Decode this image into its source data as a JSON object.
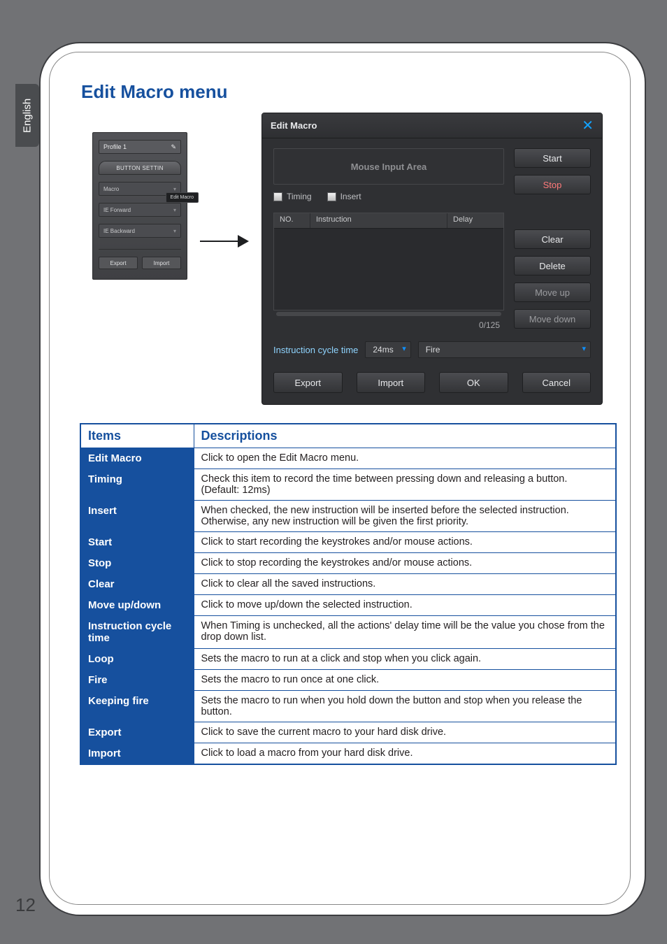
{
  "page_number": "12",
  "side_tab": "English",
  "section_title": "Edit Macro menu",
  "mini_panel": {
    "profile_label": "Profile 1",
    "tab_label": "BUTTON SETTIN",
    "rows": [
      {
        "label": "Macro",
        "submenu": "Edit Macro"
      },
      {
        "label": "IE Forward"
      },
      {
        "label": "IE Backward"
      }
    ],
    "export_label": "Export",
    "import_label": "Import"
  },
  "edit_macro_window": {
    "title": "Edit Macro",
    "mouse_input_area": "Mouse Input Area",
    "timing_label": "Timing",
    "insert_label": "Insert",
    "table_headers": {
      "no": "NO.",
      "instruction": "Instruction",
      "delay": "Delay"
    },
    "count": "0/125",
    "cycle_label": "Instruction cycle time",
    "cycle_value": "24ms",
    "mode_value": "Fire",
    "buttons": {
      "start": "Start",
      "stop": "Stop",
      "clear": "Clear",
      "delete": "Delete",
      "move_up": "Move up",
      "move_down": "Move down",
      "export": "Export",
      "import": "Import",
      "ok": "OK",
      "cancel": "Cancel"
    }
  },
  "desc_table": {
    "head_items": "Items",
    "head_desc": "Descriptions",
    "rows": [
      {
        "item": "Edit Macro",
        "desc": "Click to open the Edit Macro menu."
      },
      {
        "item": "Timing",
        "desc": "Check this item to record the time between pressing down and releasing a button. (Default: 12ms)"
      },
      {
        "item": "Insert",
        "desc": "When checked, the new instruction will be inserted before the selected instruction. Otherwise, any new instruction will be given the first priority."
      },
      {
        "item": "Start",
        "desc": "Click to start recording the keystrokes and/or mouse actions."
      },
      {
        "item": "Stop",
        "desc": "Click to stop recording the keystrokes and/or mouse actions."
      },
      {
        "item": "Clear",
        "desc": "Click to clear all the saved instructions."
      },
      {
        "item": "Move up/down",
        "desc": "Click to move up/down the selected instruction."
      },
      {
        "item": "Instruction cycle time",
        "desc": "When Timing is unchecked, all the actions' delay time will be the value you chose from the drop down list."
      },
      {
        "item": "Loop",
        "desc": "Sets the macro to run at a click and stop when you click again."
      },
      {
        "item": "Fire",
        "desc": "Sets the macro to run once at one click."
      },
      {
        "item": "Keeping fire",
        "desc": "Sets the macro to run when you hold down the button and stop when you release the button."
      },
      {
        "item": "Export",
        "desc": "Click to save the current macro to your hard disk drive."
      },
      {
        "item": "Import",
        "desc": "Click to load a macro from your hard disk drive."
      }
    ]
  }
}
